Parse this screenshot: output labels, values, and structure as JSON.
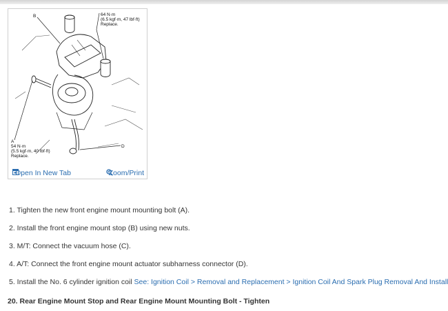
{
  "figure": {
    "callouts": {
      "b": "B",
      "torque_top_line1": "64 N·m",
      "torque_top_line2": "(6.5 kgf·m, 47 lbf·ft)",
      "torque_top_line3": "Replace.",
      "a": "A",
      "torque_a_line1": "54 N·m",
      "torque_a_line2": "(5.5 kgf·m, 40 lbf·ft)",
      "torque_a_line3": "Replace.",
      "d": "D"
    },
    "open_tab_label": "Open In New Tab",
    "zoom_label": "Zoom/Print",
    "icons": {
      "open_tab": "open-in-new-tab-icon",
      "zoom": "zoom-magnifier-icon"
    }
  },
  "steps": [
    {
      "text": "1. Tighten the new front engine mount mounting bolt (A)."
    },
    {
      "text": "2. Install the front engine mount stop (B) using new nuts."
    },
    {
      "text": "3. M/T: Connect the vacuum hose (C)."
    },
    {
      "text": "4. A/T: Connect the front engine mount actuator subharness connector (D)."
    },
    {
      "text": "5. Install the No. 6 cylinder ignition coil ",
      "link": "See: Ignition Coil > Removal and Replacement > Ignition Coil And Spark Plug Removal And Installation."
    }
  ],
  "section_title": "20. Rear Engine Mount Stop and Rear Engine Mount Mounting Bolt - Tighten",
  "colors": {
    "link": "#2a6db0",
    "text": "#333333",
    "border": "#cfcfcf"
  }
}
